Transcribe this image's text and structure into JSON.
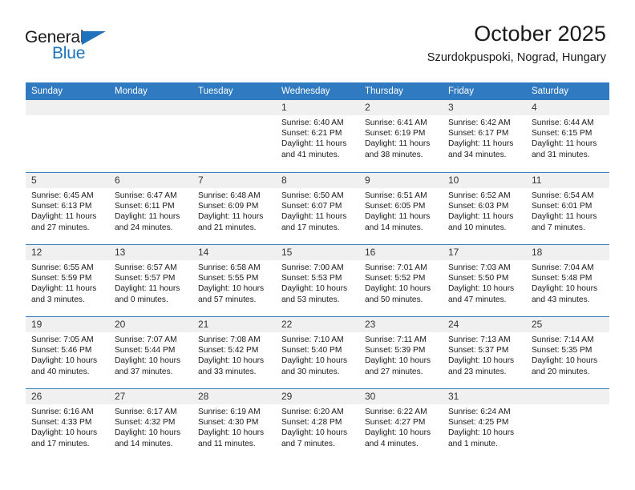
{
  "brand": {
    "name_top": "General",
    "name_bottom": "Blue",
    "triangle_icon": "brand-triangle-icon",
    "accent_color": "#1f72bd"
  },
  "header": {
    "title": "October 2025",
    "subtitle": "Szurdokpuspoki, Nograd, Hungary"
  },
  "theme": {
    "header_bar_color": "#2f7ac0",
    "row_divider_color": "#3b7fbf",
    "day_band_color": "#f0f0f0"
  },
  "weekdays": [
    "Sunday",
    "Monday",
    "Tuesday",
    "Wednesday",
    "Thursday",
    "Friday",
    "Saturday"
  ],
  "weeks": [
    [
      {
        "day": "",
        "empty": true,
        "sunrise": "",
        "sunset": "",
        "daylight_line1": "",
        "daylight_line2": ""
      },
      {
        "day": "",
        "empty": true,
        "sunrise": "",
        "sunset": "",
        "daylight_line1": "",
        "daylight_line2": ""
      },
      {
        "day": "",
        "empty": true,
        "sunrise": "",
        "sunset": "",
        "daylight_line1": "",
        "daylight_line2": ""
      },
      {
        "day": "1",
        "sunrise": "Sunrise: 6:40 AM",
        "sunset": "Sunset: 6:21 PM",
        "daylight_line1": "Daylight: 11 hours",
        "daylight_line2": "and 41 minutes."
      },
      {
        "day": "2",
        "sunrise": "Sunrise: 6:41 AM",
        "sunset": "Sunset: 6:19 PM",
        "daylight_line1": "Daylight: 11 hours",
        "daylight_line2": "and 38 minutes."
      },
      {
        "day": "3",
        "sunrise": "Sunrise: 6:42 AM",
        "sunset": "Sunset: 6:17 PM",
        "daylight_line1": "Daylight: 11 hours",
        "daylight_line2": "and 34 minutes."
      },
      {
        "day": "4",
        "sunrise": "Sunrise: 6:44 AM",
        "sunset": "Sunset: 6:15 PM",
        "daylight_line1": "Daylight: 11 hours",
        "daylight_line2": "and 31 minutes."
      }
    ],
    [
      {
        "day": "5",
        "sunrise": "Sunrise: 6:45 AM",
        "sunset": "Sunset: 6:13 PM",
        "daylight_line1": "Daylight: 11 hours",
        "daylight_line2": "and 27 minutes."
      },
      {
        "day": "6",
        "sunrise": "Sunrise: 6:47 AM",
        "sunset": "Sunset: 6:11 PM",
        "daylight_line1": "Daylight: 11 hours",
        "daylight_line2": "and 24 minutes."
      },
      {
        "day": "7",
        "sunrise": "Sunrise: 6:48 AM",
        "sunset": "Sunset: 6:09 PM",
        "daylight_line1": "Daylight: 11 hours",
        "daylight_line2": "and 21 minutes."
      },
      {
        "day": "8",
        "sunrise": "Sunrise: 6:50 AM",
        "sunset": "Sunset: 6:07 PM",
        "daylight_line1": "Daylight: 11 hours",
        "daylight_line2": "and 17 minutes."
      },
      {
        "day": "9",
        "sunrise": "Sunrise: 6:51 AM",
        "sunset": "Sunset: 6:05 PM",
        "daylight_line1": "Daylight: 11 hours",
        "daylight_line2": "and 14 minutes."
      },
      {
        "day": "10",
        "sunrise": "Sunrise: 6:52 AM",
        "sunset": "Sunset: 6:03 PM",
        "daylight_line1": "Daylight: 11 hours",
        "daylight_line2": "and 10 minutes."
      },
      {
        "day": "11",
        "sunrise": "Sunrise: 6:54 AM",
        "sunset": "Sunset: 6:01 PM",
        "daylight_line1": "Daylight: 11 hours",
        "daylight_line2": "and 7 minutes."
      }
    ],
    [
      {
        "day": "12",
        "sunrise": "Sunrise: 6:55 AM",
        "sunset": "Sunset: 5:59 PM",
        "daylight_line1": "Daylight: 11 hours",
        "daylight_line2": "and 3 minutes."
      },
      {
        "day": "13",
        "sunrise": "Sunrise: 6:57 AM",
        "sunset": "Sunset: 5:57 PM",
        "daylight_line1": "Daylight: 11 hours",
        "daylight_line2": "and 0 minutes."
      },
      {
        "day": "14",
        "sunrise": "Sunrise: 6:58 AM",
        "sunset": "Sunset: 5:55 PM",
        "daylight_line1": "Daylight: 10 hours",
        "daylight_line2": "and 57 minutes."
      },
      {
        "day": "15",
        "sunrise": "Sunrise: 7:00 AM",
        "sunset": "Sunset: 5:53 PM",
        "daylight_line1": "Daylight: 10 hours",
        "daylight_line2": "and 53 minutes."
      },
      {
        "day": "16",
        "sunrise": "Sunrise: 7:01 AM",
        "sunset": "Sunset: 5:52 PM",
        "daylight_line1": "Daylight: 10 hours",
        "daylight_line2": "and 50 minutes."
      },
      {
        "day": "17",
        "sunrise": "Sunrise: 7:03 AM",
        "sunset": "Sunset: 5:50 PM",
        "daylight_line1": "Daylight: 10 hours",
        "daylight_line2": "and 47 minutes."
      },
      {
        "day": "18",
        "sunrise": "Sunrise: 7:04 AM",
        "sunset": "Sunset: 5:48 PM",
        "daylight_line1": "Daylight: 10 hours",
        "daylight_line2": "and 43 minutes."
      }
    ],
    [
      {
        "day": "19",
        "sunrise": "Sunrise: 7:05 AM",
        "sunset": "Sunset: 5:46 PM",
        "daylight_line1": "Daylight: 10 hours",
        "daylight_line2": "and 40 minutes."
      },
      {
        "day": "20",
        "sunrise": "Sunrise: 7:07 AM",
        "sunset": "Sunset: 5:44 PM",
        "daylight_line1": "Daylight: 10 hours",
        "daylight_line2": "and 37 minutes."
      },
      {
        "day": "21",
        "sunrise": "Sunrise: 7:08 AM",
        "sunset": "Sunset: 5:42 PM",
        "daylight_line1": "Daylight: 10 hours",
        "daylight_line2": "and 33 minutes."
      },
      {
        "day": "22",
        "sunrise": "Sunrise: 7:10 AM",
        "sunset": "Sunset: 5:40 PM",
        "daylight_line1": "Daylight: 10 hours",
        "daylight_line2": "and 30 minutes."
      },
      {
        "day": "23",
        "sunrise": "Sunrise: 7:11 AM",
        "sunset": "Sunset: 5:39 PM",
        "daylight_line1": "Daylight: 10 hours",
        "daylight_line2": "and 27 minutes."
      },
      {
        "day": "24",
        "sunrise": "Sunrise: 7:13 AM",
        "sunset": "Sunset: 5:37 PM",
        "daylight_line1": "Daylight: 10 hours",
        "daylight_line2": "and 23 minutes."
      },
      {
        "day": "25",
        "sunrise": "Sunrise: 7:14 AM",
        "sunset": "Sunset: 5:35 PM",
        "daylight_line1": "Daylight: 10 hours",
        "daylight_line2": "and 20 minutes."
      }
    ],
    [
      {
        "day": "26",
        "sunrise": "Sunrise: 6:16 AM",
        "sunset": "Sunset: 4:33 PM",
        "daylight_line1": "Daylight: 10 hours",
        "daylight_line2": "and 17 minutes."
      },
      {
        "day": "27",
        "sunrise": "Sunrise: 6:17 AM",
        "sunset": "Sunset: 4:32 PM",
        "daylight_line1": "Daylight: 10 hours",
        "daylight_line2": "and 14 minutes."
      },
      {
        "day": "28",
        "sunrise": "Sunrise: 6:19 AM",
        "sunset": "Sunset: 4:30 PM",
        "daylight_line1": "Daylight: 10 hours",
        "daylight_line2": "and 11 minutes."
      },
      {
        "day": "29",
        "sunrise": "Sunrise: 6:20 AM",
        "sunset": "Sunset: 4:28 PM",
        "daylight_line1": "Daylight: 10 hours",
        "daylight_line2": "and 7 minutes."
      },
      {
        "day": "30",
        "sunrise": "Sunrise: 6:22 AM",
        "sunset": "Sunset: 4:27 PM",
        "daylight_line1": "Daylight: 10 hours",
        "daylight_line2": "and 4 minutes."
      },
      {
        "day": "31",
        "sunrise": "Sunrise: 6:24 AM",
        "sunset": "Sunset: 4:25 PM",
        "daylight_line1": "Daylight: 10 hours",
        "daylight_line2": "and 1 minute."
      },
      {
        "day": "",
        "empty": true,
        "sunrise": "",
        "sunset": "",
        "daylight_line1": "",
        "daylight_line2": ""
      }
    ]
  ]
}
